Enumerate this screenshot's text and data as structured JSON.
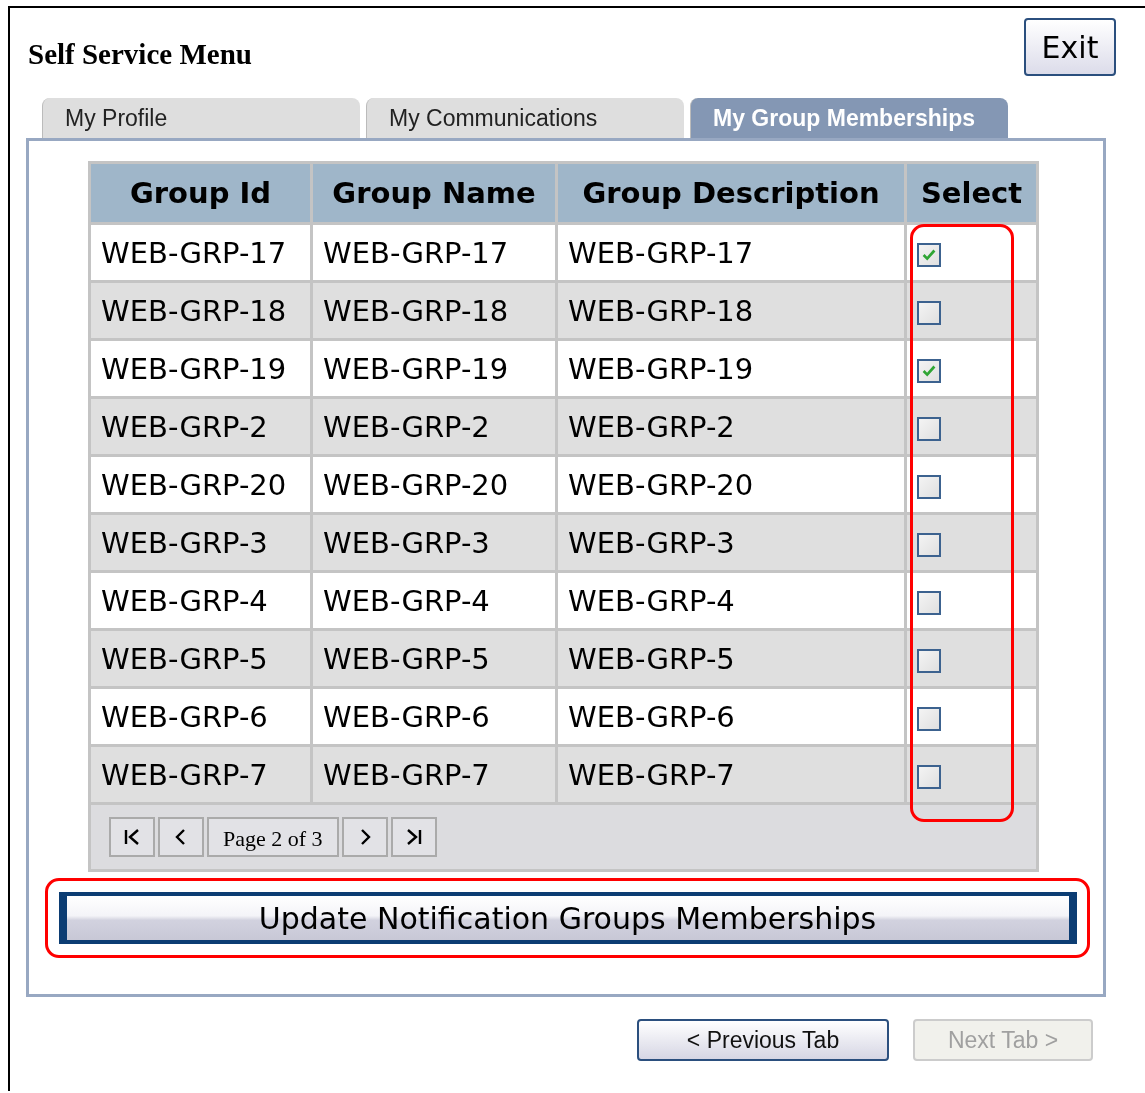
{
  "window": {
    "title": "Self Service Menu"
  },
  "exit_button": "Exit",
  "tabs": [
    {
      "label": "My Profile",
      "selected": false
    },
    {
      "label": "My Communications",
      "selected": false
    },
    {
      "label": "My Group Memberships",
      "selected": true
    }
  ],
  "table": {
    "columns": [
      "Group Id",
      "Group Name",
      "Group Description",
      "Select"
    ],
    "rows": [
      {
        "cells": [
          "WEB-GRP-17",
          "WEB-GRP-17",
          "WEB-GRP-17"
        ],
        "checked": true
      },
      {
        "cells": [
          "WEB-GRP-18",
          "WEB-GRP-18",
          "WEB-GRP-18"
        ],
        "checked": false
      },
      {
        "cells": [
          "WEB-GRP-19",
          "WEB-GRP-19",
          "WEB-GRP-19"
        ],
        "checked": true
      },
      {
        "cells": [
          "WEB-GRP-2",
          "WEB-GRP-2",
          "WEB-GRP-2"
        ],
        "checked": false
      },
      {
        "cells": [
          "WEB-GRP-20",
          "WEB-GRP-20",
          "WEB-GRP-20"
        ],
        "checked": false
      },
      {
        "cells": [
          "WEB-GRP-3",
          "WEB-GRP-3",
          "WEB-GRP-3"
        ],
        "checked": false
      },
      {
        "cells": [
          "WEB-GRP-4",
          "WEB-GRP-4",
          "WEB-GRP-4"
        ],
        "checked": false
      },
      {
        "cells": [
          "WEB-GRP-5",
          "WEB-GRP-5",
          "WEB-GRP-5"
        ],
        "checked": false
      },
      {
        "cells": [
          "WEB-GRP-6",
          "WEB-GRP-6",
          "WEB-GRP-6"
        ],
        "checked": false
      },
      {
        "cells": [
          "WEB-GRP-7",
          "WEB-GRP-7",
          "WEB-GRP-7"
        ],
        "checked": false
      }
    ],
    "pager": {
      "page_label": "Page 2 of 3"
    }
  },
  "update_button": "Update Notification Groups Memberships",
  "nav_buttons": [
    {
      "label": "< Previous Tab",
      "disabled": false
    },
    {
      "label": "Next Tab >",
      "disabled": true
    }
  ]
}
